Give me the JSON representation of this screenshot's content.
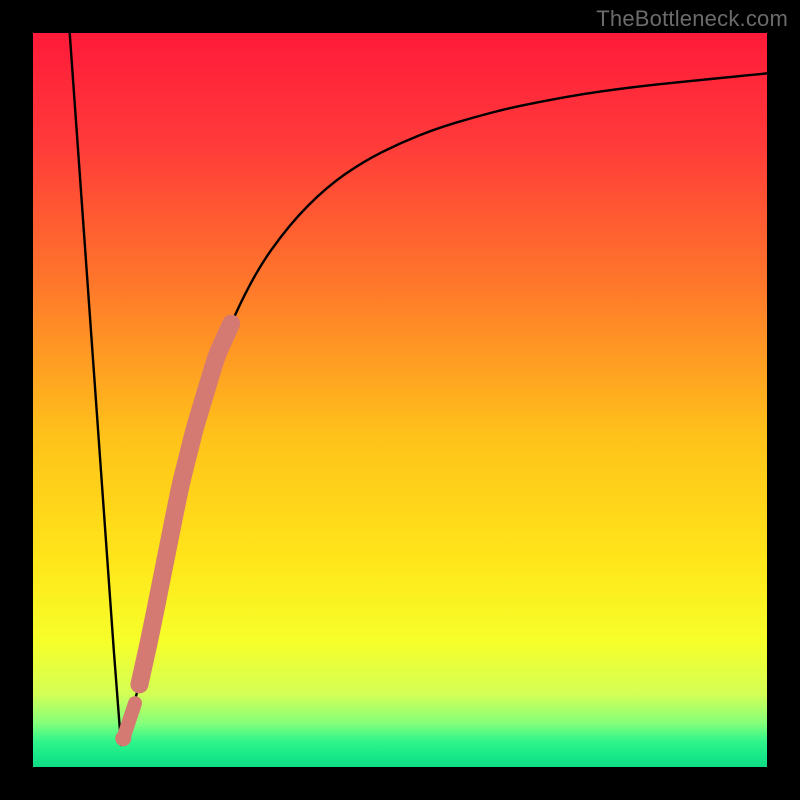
{
  "watermark": "TheBottleneck.com",
  "colors": {
    "frame": "#000000",
    "gradient_stops": [
      {
        "offset": 0.0,
        "color": "#ff1a3a"
      },
      {
        "offset": 0.15,
        "color": "#ff3a3a"
      },
      {
        "offset": 0.35,
        "color": "#ff7a2a"
      },
      {
        "offset": 0.55,
        "color": "#ffc21a"
      },
      {
        "offset": 0.72,
        "color": "#ffe61a"
      },
      {
        "offset": 0.83,
        "color": "#f6ff2a"
      },
      {
        "offset": 0.9,
        "color": "#d4ff55"
      },
      {
        "offset": 0.94,
        "color": "#86ff7a"
      },
      {
        "offset": 0.965,
        "color": "#30f58a"
      },
      {
        "offset": 0.985,
        "color": "#18e888"
      },
      {
        "offset": 1.0,
        "color": "#0fdc84"
      }
    ],
    "curve": "#000000",
    "highlight": "#d57a72"
  },
  "chart_data": {
    "type": "line",
    "title": "",
    "xlabel": "",
    "ylabel": "",
    "xlim": [
      0,
      100
    ],
    "ylim": [
      0,
      100
    ],
    "notes": "V-shaped bottleneck curve. Vertex near x≈12, y≈3. Left branch is a steep straight descent from top-left. Right branch rises with diminishing slope toward upper-right. Thick salmon highlight overlaid on right branch near x≈16–26.",
    "series": [
      {
        "name": "left-branch",
        "x": [
          5,
          6,
          7,
          8,
          9,
          10,
          11,
          12
        ],
        "y": [
          100,
          86,
          72,
          58,
          44,
          30,
          16,
          3
        ]
      },
      {
        "name": "right-branch",
        "x": [
          12,
          14,
          16,
          18,
          20,
          22,
          25,
          30,
          35,
          40,
          45,
          50,
          55,
          60,
          65,
          70,
          75,
          80,
          85,
          90,
          95,
          100
        ],
        "y": [
          3,
          9,
          18,
          28,
          38,
          46,
          56,
          67,
          74,
          79,
          82.5,
          85,
          87,
          88.5,
          89.8,
          90.8,
          91.7,
          92.4,
          93,
          93.5,
          94,
          94.5
        ]
      }
    ],
    "highlight_segment": {
      "on_series": "right-branch",
      "x_range": [
        14.5,
        27
      ],
      "style": "thick-rounded"
    }
  }
}
